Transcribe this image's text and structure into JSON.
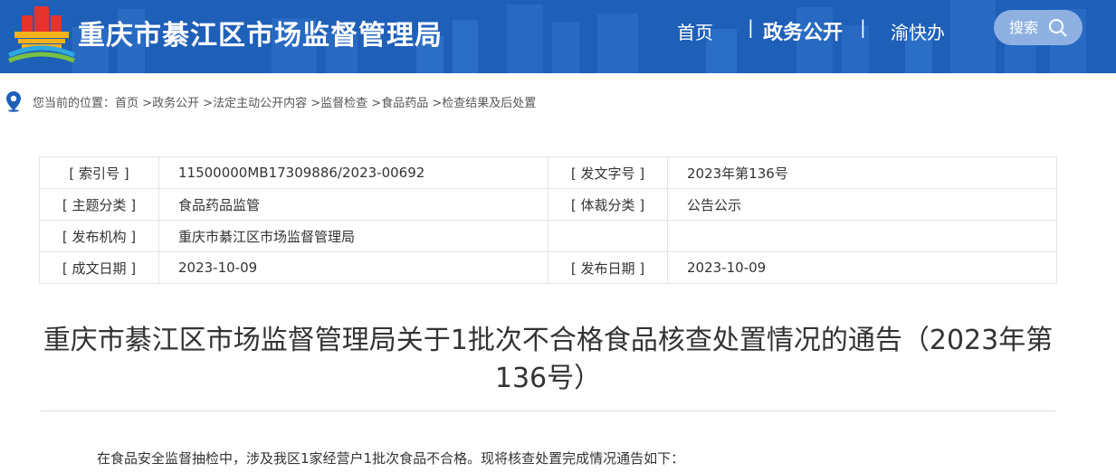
{
  "header": {
    "site_title": "重庆市綦江区市场监督管理局",
    "nav": {
      "home": "首页",
      "sep": "|",
      "gov": "政务公开",
      "yukuaiban": "渝快办"
    },
    "search_label": "搜索"
  },
  "breadcrumb": {
    "prefix": "您当前的位置：",
    "items": [
      "首页",
      "政务公开",
      "法定主动公开内容",
      "监督检查",
      "食品药品",
      "检查结果及后处置"
    ],
    "sep": " >"
  },
  "meta": {
    "rows": [
      {
        "l1": "[ 索引号 ]",
        "v1": "11500000MB17309886/2023-00692",
        "l2": "[ 发文字号 ]",
        "v2": "2023年第136号"
      },
      {
        "l1": "[ 主题分类 ]",
        "v1": "食品药品监管",
        "l2": "[ 体裁分类 ]",
        "v2": "公告公示"
      },
      {
        "l1": "[ 发布机构 ]",
        "v1": "重庆市綦江区市场监督管理局",
        "l2": "",
        "v2": ""
      },
      {
        "l1": "[ 成文日期 ]",
        "v1": "2023-10-09",
        "l2": "[ 发布日期 ]",
        "v2": "2023-10-09"
      }
    ]
  },
  "document": {
    "title": "重庆市綦江区市场监督管理局关于1批次不合格食品核查处置情况的通告（2023年第136号）",
    "intro": "在食品安全监督抽检中，涉及我区1家经营户1批次食品不合格。现将核查处置完成情况通告如下："
  },
  "colors": {
    "header_bg": "#1e5fb8",
    "search_bg": "#8fb1e2",
    "location_icon": "#1e5fb8"
  }
}
